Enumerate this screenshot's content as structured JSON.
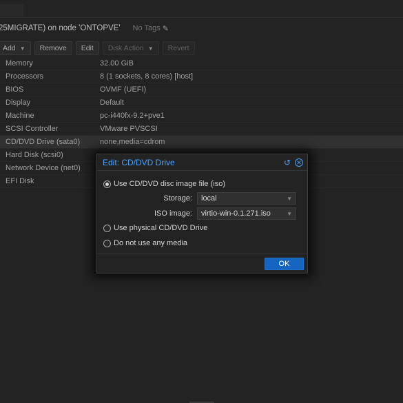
{
  "header": {
    "vm_title": "25MIGRATE) on node 'ONTOPVE'",
    "tags_label": "No Tags"
  },
  "toolbar": {
    "add": "Add",
    "remove": "Remove",
    "edit": "Edit",
    "disk_action": "Disk Action",
    "revert": "Revert"
  },
  "hardware": {
    "rows": [
      {
        "key": "Memory",
        "value": "32.00 GiB"
      },
      {
        "key": "Processors",
        "value": "8 (1 sockets, 8 cores) [host]"
      },
      {
        "key": "BIOS",
        "value": "OVMF (UEFI)"
      },
      {
        "key": "Display",
        "value": "Default"
      },
      {
        "key": "Machine",
        "value": "pc-i440fx-9.2+pve1"
      },
      {
        "key": "SCSI Controller",
        "value": "VMware PVSCSI"
      },
      {
        "key": "CD/DVD Drive (sata0)",
        "value": "none,media=cdrom"
      },
      {
        "key": "Hard Disk (scsi0)",
        "value": ""
      },
      {
        "key": "Network Device (net0)",
        "value": ""
      },
      {
        "key": "EFI Disk",
        "value": ""
      }
    ]
  },
  "dialog": {
    "title": "Edit: CD/DVD Drive",
    "option_iso": "Use CD/DVD disc image file (iso)",
    "storage_label": "Storage:",
    "storage_value": "local",
    "iso_label": "ISO image:",
    "iso_value": "virtio-win-0.1.271.iso",
    "option_physical": "Use physical CD/DVD Drive",
    "option_none": "Do not use any media",
    "ok_label": "OK",
    "selected_option": "iso"
  },
  "colors": {
    "accent": "#4aa3ff",
    "primary_button": "#1565c0",
    "background": "#2b2b2b"
  }
}
